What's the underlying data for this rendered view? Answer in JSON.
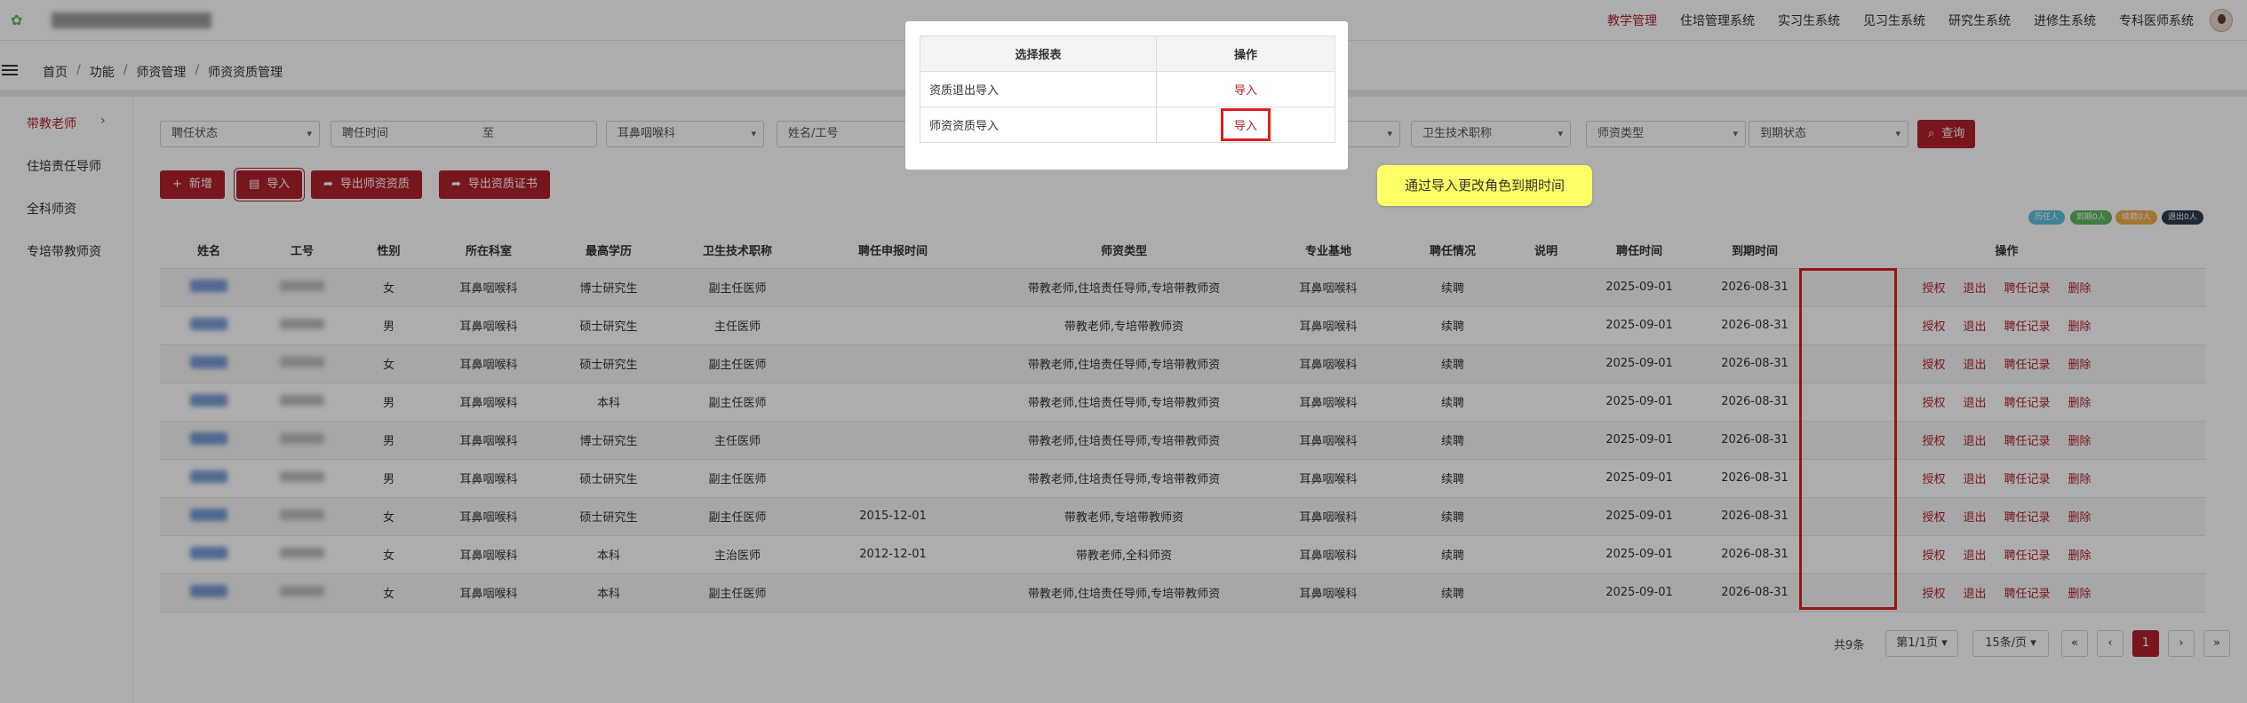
{
  "topbar": {
    "nav": [
      "教学管理",
      "住培管理系统",
      "实习生系统",
      "见习生系统",
      "研究生系统",
      "进修生系统",
      "专科医师系统"
    ],
    "active_index": 0
  },
  "breadcrumb": [
    "首页",
    "功能",
    "师资管理",
    "师资资质管理"
  ],
  "sidebar": {
    "items": [
      "带教老师",
      "住培责任导师",
      "全科师资",
      "专培带教师资"
    ],
    "active_index": 0
  },
  "filters": {
    "status": "聘任状态",
    "appoint_time": "聘任时间",
    "range_sep": "至",
    "dept": "耳鼻咽喉科",
    "name_id": "姓名/工号",
    "tech_title": "卫生技术职称",
    "teacher_type": "师资类型",
    "expire_status": "到期状态",
    "search_label": "查询"
  },
  "toolbar": {
    "add_label": "新增",
    "import_label": "导入",
    "export_teachers_label": "导出师资资质",
    "export_cert_label": "导出资质证书"
  },
  "legend": [
    {
      "label": "历任人",
      "color": "#5bc0de"
    },
    {
      "label": "到期0人",
      "color": "#5cb85c"
    },
    {
      "label": "续聘0人",
      "color": "#f0ad4e"
    },
    {
      "label": "退出0人",
      "color": "#2c3e50"
    }
  ],
  "table": {
    "headers": [
      "姓名",
      "工号",
      "性别",
      "所在科室",
      "最高学历",
      "卫生技术职称",
      "聘任申报时间",
      "师资类型",
      "专业基地",
      "聘任情况",
      "说明",
      "聘任时间",
      "到期时间",
      "操作"
    ],
    "actions": [
      "授权",
      "退出",
      "聘任记录",
      "删除"
    ],
    "rows": [
      {
        "gender": "女",
        "dept": "耳鼻咽喉科",
        "edu": "博士研究生",
        "title": "副主任医师",
        "apply": "",
        "type": "带教老师,住培责任导师,专培带教师资",
        "base": "耳鼻咽喉科",
        "status": "续聘",
        "note": "",
        "appoint": "2025-09-01",
        "expire": "2026-08-31"
      },
      {
        "gender": "男",
        "dept": "耳鼻咽喉科",
        "edu": "硕士研究生",
        "title": "主任医师",
        "apply": "",
        "type": "带教老师,专培带教师资",
        "base": "耳鼻咽喉科",
        "status": "续聘",
        "note": "",
        "appoint": "2025-09-01",
        "expire": "2026-08-31"
      },
      {
        "gender": "女",
        "dept": "耳鼻咽喉科",
        "edu": "硕士研究生",
        "title": "副主任医师",
        "apply": "",
        "type": "带教老师,住培责任导师,专培带教师资",
        "base": "耳鼻咽喉科",
        "status": "续聘",
        "note": "",
        "appoint": "2025-09-01",
        "expire": "2026-08-31"
      },
      {
        "gender": "男",
        "dept": "耳鼻咽喉科",
        "edu": "本科",
        "title": "副主任医师",
        "apply": "",
        "type": "带教老师,住培责任导师,专培带教师资",
        "base": "耳鼻咽喉科",
        "status": "续聘",
        "note": "",
        "appoint": "2025-09-01",
        "expire": "2026-08-31"
      },
      {
        "gender": "男",
        "dept": "耳鼻咽喉科",
        "edu": "博士研究生",
        "title": "主任医师",
        "apply": "",
        "type": "带教老师,住培责任导师,专培带教师资",
        "base": "耳鼻咽喉科",
        "status": "续聘",
        "note": "",
        "appoint": "2025-09-01",
        "expire": "2026-08-31"
      },
      {
        "gender": "男",
        "dept": "耳鼻咽喉科",
        "edu": "硕士研究生",
        "title": "副主任医师",
        "apply": "",
        "type": "带教老师,住培责任导师,专培带教师资",
        "base": "耳鼻咽喉科",
        "status": "续聘",
        "note": "",
        "appoint": "2025-09-01",
        "expire": "2026-08-31"
      },
      {
        "gender": "女",
        "dept": "耳鼻咽喉科",
        "edu": "硕士研究生",
        "title": "副主任医师",
        "apply": "2015-12-01",
        "type": "带教老师,专培带教师资",
        "base": "耳鼻咽喉科",
        "status": "续聘",
        "note": "",
        "appoint": "2025-09-01",
        "expire": "2026-08-31"
      },
      {
        "gender": "女",
        "dept": "耳鼻咽喉科",
        "edu": "本科",
        "title": "主治医师",
        "apply": "2012-12-01",
        "type": "带教老师,全科师资",
        "base": "耳鼻咽喉科",
        "status": "续聘",
        "note": "",
        "appoint": "2025-09-01",
        "expire": "2026-08-31"
      },
      {
        "gender": "女",
        "dept": "耳鼻咽喉科",
        "edu": "本科",
        "title": "副主任医师",
        "apply": "",
        "type": "带教老师,住培责任导师,专培带教师资",
        "base": "耳鼻咽喉科",
        "status": "续聘",
        "note": "",
        "appoint": "2025-09-01",
        "expire": "2026-08-31"
      }
    ]
  },
  "pagination": {
    "total": "共9条",
    "page_select": "第1/1页",
    "size_select": "15条/页",
    "first": "«",
    "prev": "‹",
    "current": "1",
    "next": "›",
    "last": "»"
  },
  "modal": {
    "headers": [
      "选择报表",
      "操作"
    ],
    "rows": [
      {
        "name": "资质退出导入",
        "action": "导入"
      },
      {
        "name": "师资资质导入",
        "action": "导入"
      }
    ]
  },
  "tip": "通过导入更改角色到期时间",
  "colors": {
    "accent": "#b2212c",
    "highlight": "#e01e1e",
    "tip_bg": "#ffff66"
  }
}
